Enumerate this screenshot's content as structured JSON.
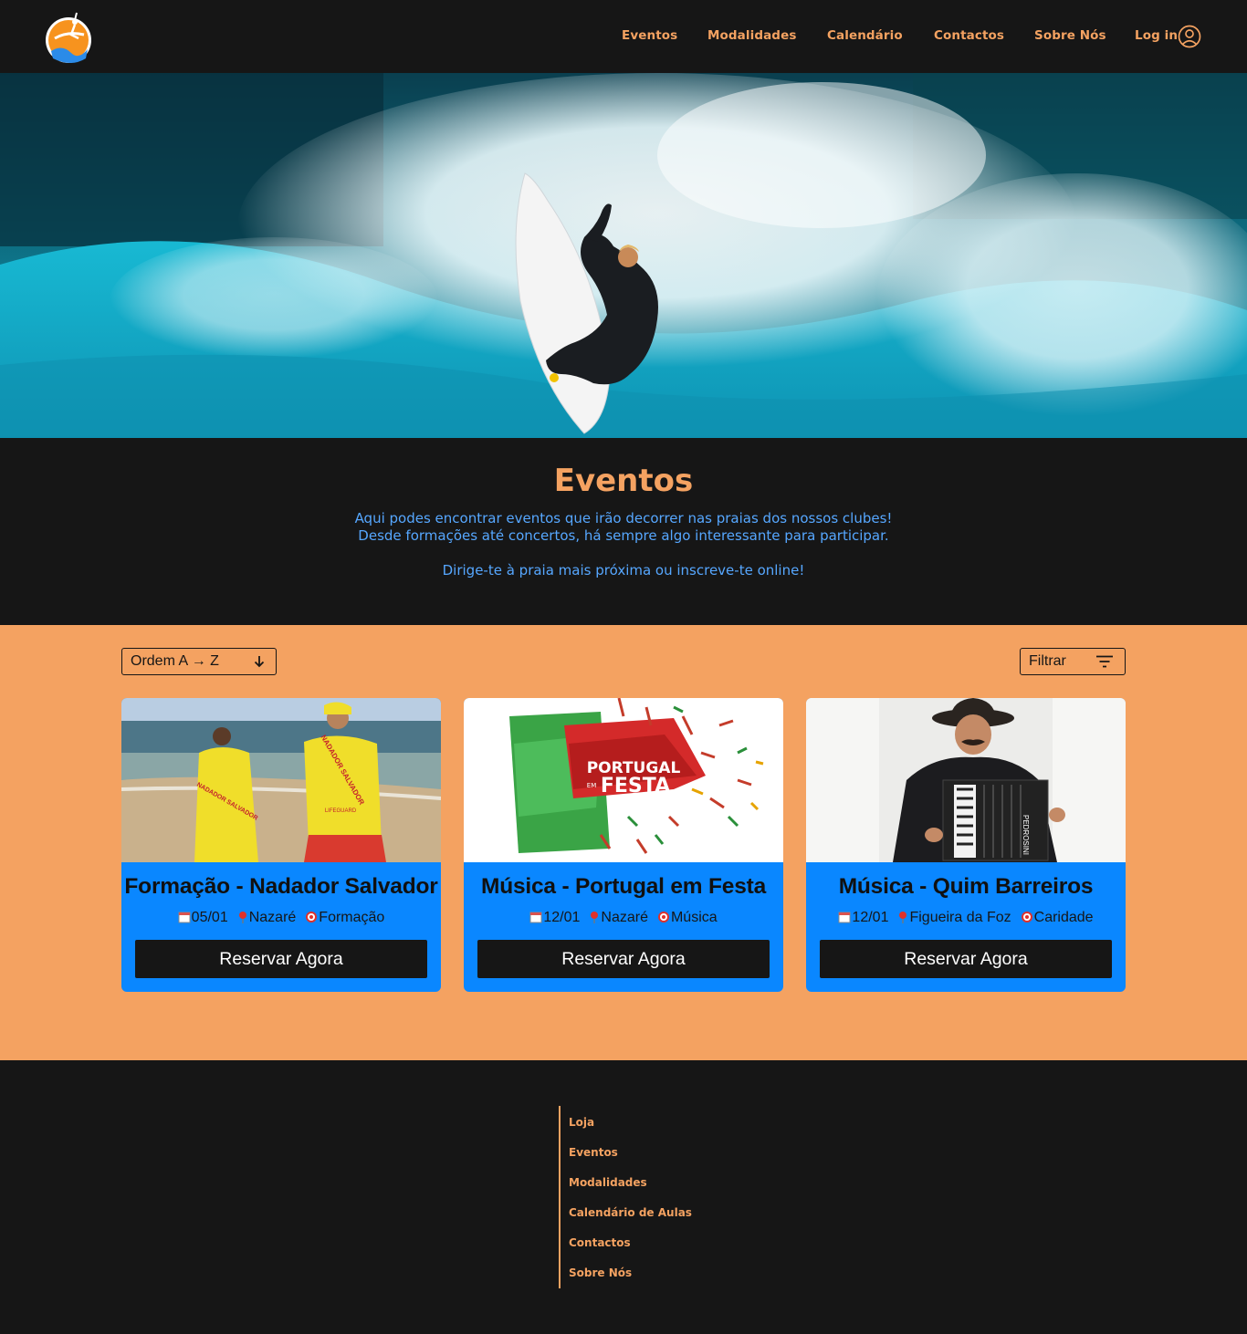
{
  "nav": {
    "items": [
      "Eventos",
      "Modalidades",
      "Calendário",
      "Contactos",
      "Sobre Nós"
    ],
    "login_label": "Log in"
  },
  "intro": {
    "title": "Eventos",
    "line1": "Aqui podes encontrar eventos que irão decorrer nas praias dos nossos clubes!",
    "line2": "Desde formações até concertos, há sempre algo interessante para participar.",
    "line3": "Dirige-te à praia mais próxima ou inscreve-te online!"
  },
  "controls": {
    "sort_label": "Ordem A → Z",
    "filter_label": "Filtrar"
  },
  "events": [
    {
      "title": "Formação - Nadador Salvador",
      "date": "05/01",
      "location": "Nazaré",
      "category": "Formação",
      "button": "Reservar Agora"
    },
    {
      "title": "Música - Portugal em Festa",
      "date": "12/01",
      "location": "Nazaré",
      "category": "Música",
      "button": "Reservar Agora"
    },
    {
      "title": "Música - Quim Barreiros",
      "date": "12/01",
      "location": "Figueira da Foz",
      "category": "Caridade",
      "button": "Reservar Agora"
    }
  ],
  "event_images": {
    "vest_text": "NADADOR SALVADOR",
    "vest_subtext": "LIFEGUARD",
    "festa_top": "PORTUGAL",
    "festa_em": "EM",
    "festa_bottom": "FESTA",
    "accordion_brand": "PEDROSINI"
  },
  "footer": {
    "links": [
      "Loja",
      "Eventos",
      "Modalidades",
      "Calendário de Aulas",
      "Contactos",
      "Sobre Nós"
    ]
  },
  "colors": {
    "background": "#161616",
    "accent_orange": "#f4a261",
    "accent_blue": "#0a87ff",
    "intro_text_blue": "#56a7ff"
  },
  "icons": [
    "surf-logo-icon",
    "user-circle-icon",
    "arrow-down-icon",
    "filter-icon",
    "calendar-icon",
    "pin-icon",
    "target-icon"
  ]
}
